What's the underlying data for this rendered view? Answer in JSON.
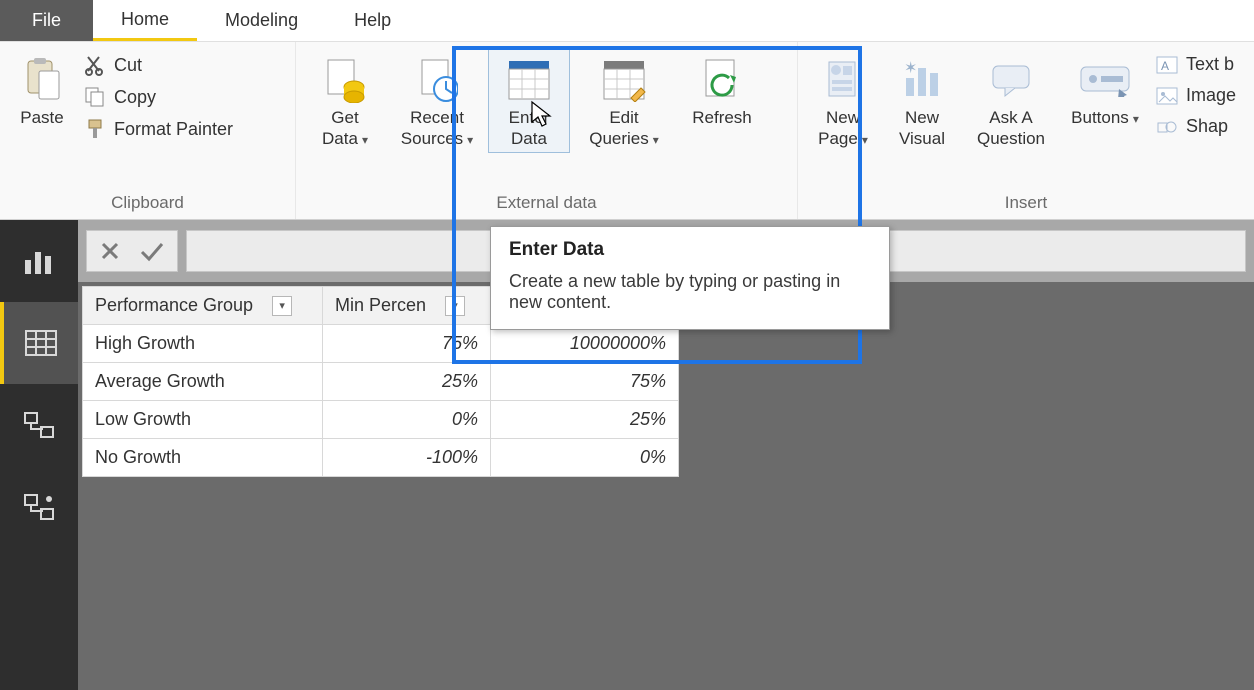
{
  "tabs": {
    "file": "File",
    "home": "Home",
    "modeling": "Modeling",
    "help": "Help"
  },
  "ribbon": {
    "clipboard": {
      "group_label": "Clipboard",
      "paste": "Paste",
      "cut": "Cut",
      "copy": "Copy",
      "format_painter": "Format Painter"
    },
    "external": {
      "group_label": "External data",
      "get_data": "Get\nData",
      "recent_sources": "Recent\nSources",
      "enter_data": "Enter\nData",
      "edit_queries": "Edit\nQueries",
      "refresh": "Refresh"
    },
    "insert": {
      "group_label": "Insert",
      "new_page": "New\nPage",
      "new_visual": "New\nVisual",
      "ask_question": "Ask A\nQuestion",
      "buttons": "Buttons",
      "text": "Text b",
      "image": "Image",
      "shapes": "Shap"
    }
  },
  "tooltip": {
    "title": "Enter Data",
    "desc": "Create a new table by typing or pasting in new content."
  },
  "table": {
    "headers": {
      "group": "Performance Group",
      "min": "Min Percen",
      "max": ""
    },
    "rows": [
      {
        "group": "High Growth",
        "min": "75%",
        "max": "10000000%"
      },
      {
        "group": "Average Growth",
        "min": "25%",
        "max": "75%"
      },
      {
        "group": "Low Growth",
        "min": "0%",
        "max": "25%"
      },
      {
        "group": "No Growth",
        "min": "-100%",
        "max": "0%"
      }
    ]
  }
}
